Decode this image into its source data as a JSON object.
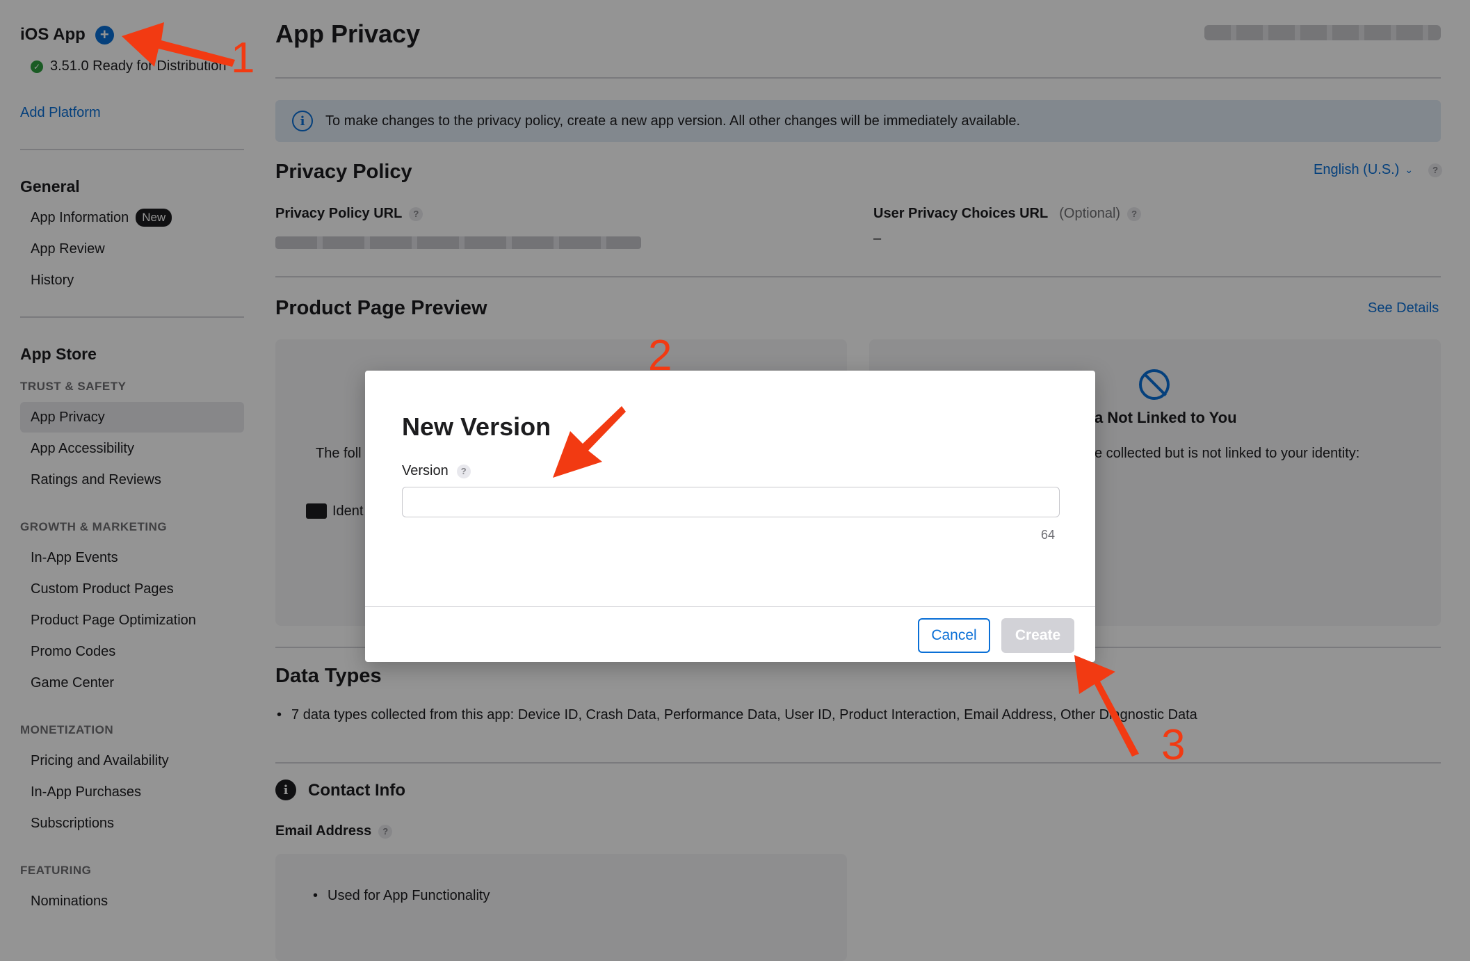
{
  "sidebar": {
    "platform_title": "iOS App",
    "status_text": "3.51.0 Ready for Distribution",
    "add_platform": "Add Platform",
    "general": {
      "heading": "General",
      "items": [
        {
          "label": "App Information",
          "badge": "New"
        },
        {
          "label": "App Review"
        },
        {
          "label": "History"
        }
      ]
    },
    "app_store": {
      "heading": "App Store",
      "trust_heading": "TRUST & SAFETY",
      "trust_items": [
        "App Privacy",
        "App Accessibility",
        "Ratings and Reviews"
      ],
      "growth_heading": "GROWTH & MARKETING",
      "growth_items": [
        "In-App Events",
        "Custom Product Pages",
        "Product Page Optimization",
        "Promo Codes",
        "Game Center"
      ],
      "monetization_heading": "MONETIZATION",
      "monetization_items": [
        "Pricing and Availability",
        "In-App Purchases",
        "Subscriptions"
      ],
      "featuring_heading": "FEATURING",
      "featuring_items": [
        "Nominations"
      ]
    }
  },
  "main": {
    "title": "App Privacy",
    "info_banner": "To make changes to the privacy policy, create a new app version. All other changes will be immediately available.",
    "privacy_policy": {
      "heading": "Privacy Policy",
      "language": "English (U.S.)",
      "url_label": "Privacy Policy URL",
      "choices_label": "User Privacy Choices URL",
      "optional": "(Optional)",
      "choices_value": "–"
    },
    "preview": {
      "heading": "Product Page Preview",
      "see_details": "See Details",
      "left_text_partial": "The foll",
      "left_item_partial": "Ident",
      "right_heading_partial": "a Not Linked to You",
      "right_text_partial": "e collected but is not linked to your identity:"
    },
    "data_types": {
      "heading": "Data Types",
      "summary": "7 data types collected from this app: Device ID, Crash Data, Performance Data, User ID, Product Interaction, Email Address, Other Diagnostic Data"
    },
    "contact_info": {
      "heading": "Contact Info",
      "email_label": "Email Address",
      "usage": "Used for App Functionality"
    }
  },
  "modal": {
    "title": "New Version",
    "version_label": "Version",
    "version_value": "",
    "char_limit": "64",
    "cancel": "Cancel",
    "create": "Create"
  },
  "annotations": {
    "one": "1",
    "two": "2",
    "three": "3",
    "color": "#f23a12"
  },
  "colors": {
    "accent": "#0a6fd6",
    "success": "#2e9e3e"
  }
}
